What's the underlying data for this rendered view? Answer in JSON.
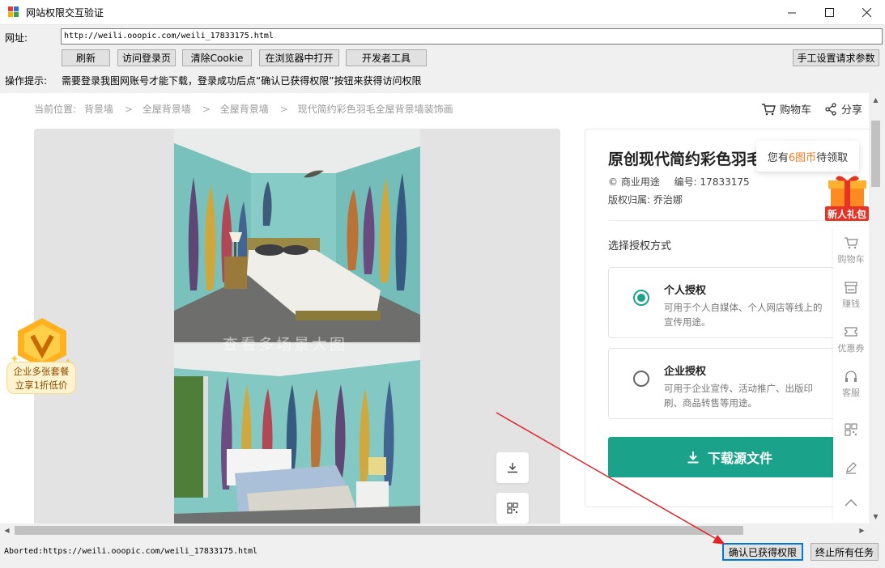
{
  "window": {
    "title": "网站权限交互验证"
  },
  "toolbar": {
    "url_label": "网址:",
    "url_value": "http://weili.ooopic.com/weili_17833175.html",
    "buttons": [
      "刷新",
      "访问登录页",
      "清除Cookie",
      "在浏览器中打开",
      "开发者工具"
    ],
    "manual_params": "手工设置请求参数",
    "hint_label": "操作提示:",
    "hint_text": "需要登录我图网账号才能下载，登录成功后点“确认已获得权限”按钮来获得访问权限"
  },
  "page": {
    "breadcrumb": [
      "当前位置:",
      "背景墙",
      "全屋背景墙",
      "全屋背景墙",
      "现代简约彩色羽毛全屋背景墙装饰画"
    ],
    "cart": "购物车",
    "share": "分享",
    "watermark": "查看多场景大图",
    "product": {
      "title": "原创现代简约彩色羽毛全屋背景墙装",
      "usage": "商业用途",
      "code_label": "编号:",
      "code": "17833175",
      "owner_label": "版权归属:",
      "owner": "乔治娜"
    },
    "license_section": "选择授权方式",
    "licenses": [
      {
        "name": "个人授权",
        "desc": "可用于个人自媒体、个人网店等线上的宣传用途。",
        "selected": true
      },
      {
        "name": "企业授权",
        "desc": "可用于企业宣传、活动推广、出版印刷、商品转售等用途。",
        "selected": false
      }
    ],
    "download": "下载源文件",
    "coin_popup": {
      "prefix": "您有",
      "amount": "6图币",
      "suffix": "待领取"
    },
    "gift_label": "新人礼包",
    "rail": [
      "购物车",
      "赚钱",
      "优惠券",
      "客服"
    ],
    "promo": {
      "line1": "企业多张套餐",
      "line2": "立享1折低价"
    },
    "accent": "#1aa38a"
  },
  "status": {
    "text": "Aborted:https://weili.ooopic.com/weili_17833175.html",
    "confirm": "确认已获得权限",
    "stop": "终止所有任务"
  }
}
